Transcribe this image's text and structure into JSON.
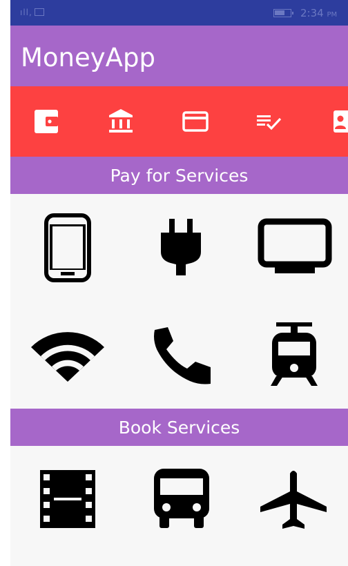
{
  "status_bar": {
    "time": "2:34",
    "time_suffix": "PM",
    "signal_icon": "signal-icon",
    "image_icon": "image-notification-icon",
    "battery_icon": "battery-icon"
  },
  "app_bar": {
    "title": "MoneyApp"
  },
  "top_nav": {
    "icons": [
      "wallet-icon",
      "bank-icon",
      "credit-card-icon",
      "playlist-check-icon",
      "contact-card-icon"
    ]
  },
  "pay_section": {
    "header": "Pay for Services",
    "items": [
      "mobile-phone-icon",
      "power-plug-icon",
      "tv-icon",
      "wifi-icon",
      "phone-icon",
      "tram-icon"
    ]
  },
  "book_section": {
    "header": "Book Services",
    "items": [
      "movie-film-icon",
      "bus-icon",
      "airplane-icon"
    ]
  },
  "colors": {
    "status_bar": "#2d3d9e",
    "app_bar": "#a667c9",
    "nav_bar": "#fd4141",
    "background": "#f7f7f7",
    "icon": "#000000"
  }
}
